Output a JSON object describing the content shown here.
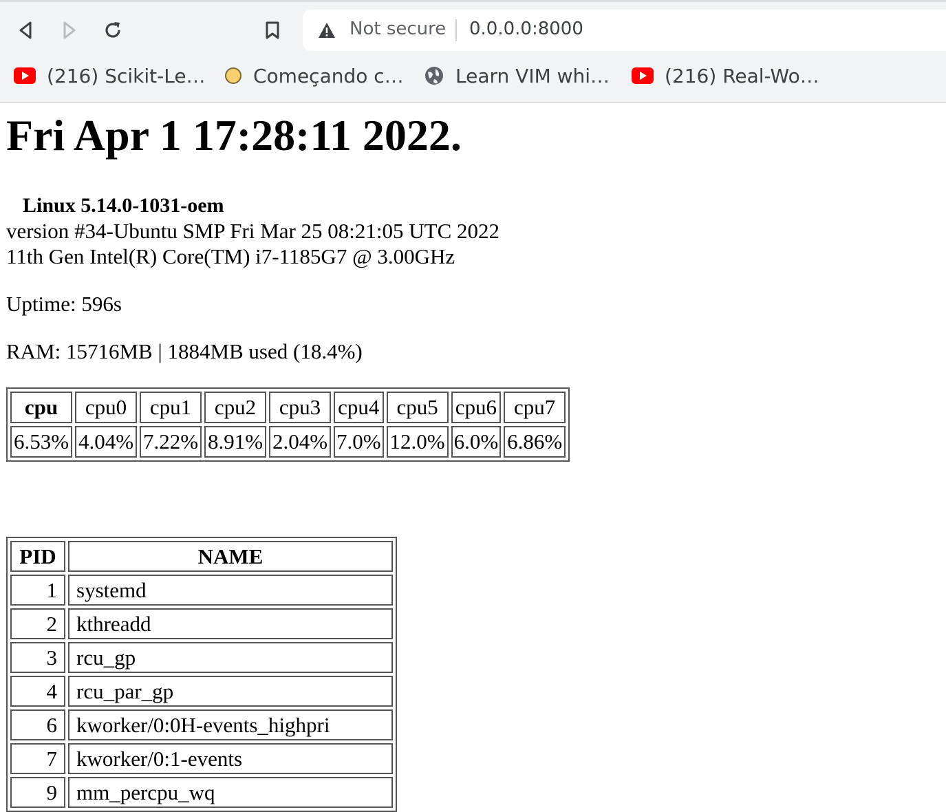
{
  "browser": {
    "security_label": "Not secure",
    "url": "0.0.0.0:8000",
    "bookmarks": [
      {
        "label": "(216) Scikit-Le…",
        "icon": "youtube-icon"
      },
      {
        "label": "Começando c…",
        "icon": "circle-favicon-icon"
      },
      {
        "label": "Learn VIM whi…",
        "icon": "globe-icon"
      },
      {
        "label": "(216) Real-Wo…",
        "icon": "youtube-icon"
      }
    ]
  },
  "page": {
    "datetime": "Fri Apr 1 17:28:11 2022.",
    "kernel": "Linux 5.14.0-1031-oem",
    "version": "version #34-Ubuntu SMP Fri Mar 25 08:21:05 UTC 2022",
    "cpu_model": "11th Gen Intel(R) Core(TM) i7-1185G7 @ 3.00GHz",
    "uptime": "Uptime: 596s",
    "ram": "RAM: 15716MB | 1884MB used (18.4%)"
  },
  "cpu_table": {
    "headers": [
      "cpu",
      "cpu0",
      "cpu1",
      "cpu2",
      "cpu3",
      "cpu4",
      "cpu5",
      "cpu6",
      "cpu7"
    ],
    "values": [
      "6.53%",
      "4.04%",
      "7.22%",
      "8.91%",
      "2.04%",
      "7.0%",
      "12.0%",
      "6.0%",
      "6.86%"
    ]
  },
  "process_table": {
    "headers": {
      "pid": "PID",
      "name": "NAME"
    },
    "rows": [
      {
        "pid": "1",
        "name": "systemd"
      },
      {
        "pid": "2",
        "name": "kthreadd"
      },
      {
        "pid": "3",
        "name": "rcu_gp"
      },
      {
        "pid": "4",
        "name": "rcu_par_gp"
      },
      {
        "pid": "6",
        "name": "kworker/0:0H-events_highpri"
      },
      {
        "pid": "7",
        "name": "kworker/0:1-events"
      },
      {
        "pid": "9",
        "name": "mm_percpu_wq"
      }
    ]
  }
}
